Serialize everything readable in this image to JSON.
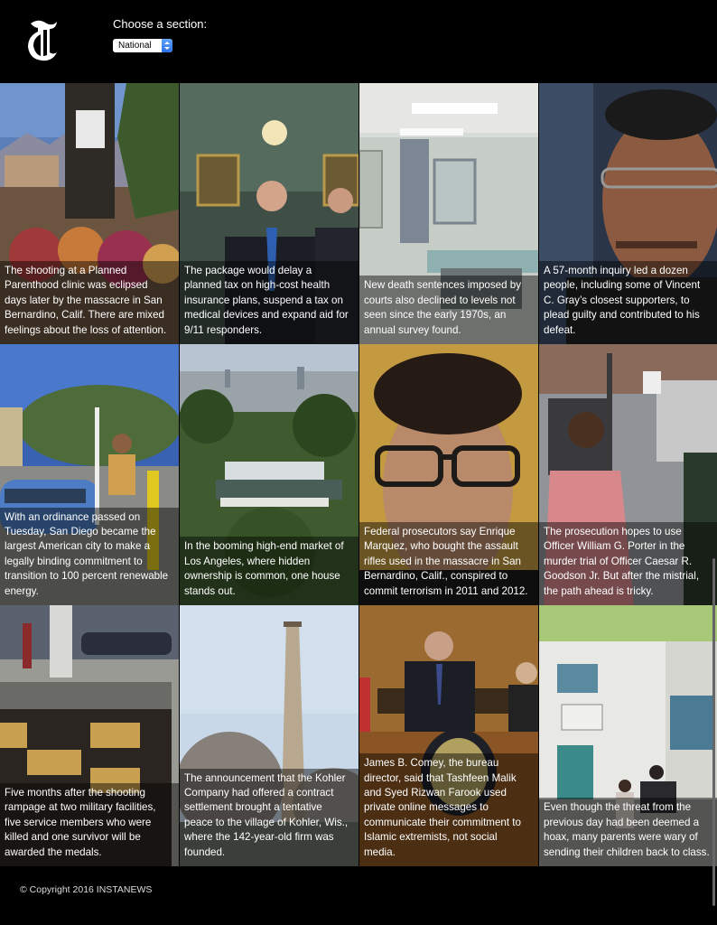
{
  "header": {
    "logo": "nyt-t-logo-icon",
    "choose_label": "Choose a section:",
    "section_value": "National"
  },
  "stories": [
    {
      "caption": "The shooting at a Planned Parenthood clinic was eclipsed days later by the massacre in San Bernardino, Calif. There are mixed feelings about the loss of attention.",
      "image": "clinic-memorial-flowers"
    },
    {
      "caption": "The package would delay a planned tax on high-cost health insurance plans, suspend a tax on medical devices and expand aid for 9/11 responders.",
      "image": "senators-press-conference"
    },
    {
      "caption": "New death sentences imposed by courts also declined to levels not seen since the early 1970s, an annual survey found.",
      "image": "execution-chamber"
    },
    {
      "caption": "A 57-month inquiry led a dozen people, including some of Vincent C. Gray’s closest supporters, to plead guilty and contributed to his defeat.",
      "image": "vincent-gray-portrait"
    },
    {
      "caption": "With an ordinance passed on Tuesday, San Diego became the largest American city to make a legally binding commitment to transition to 100 percent renewable energy.",
      "image": "electric-car-charging"
    },
    {
      "caption": "In the booming high-end market of Los Angeles, where hidden ownership is common, one house stands out.",
      "image": "los-angeles-hillside-house"
    },
    {
      "caption": "Federal prosecutors say Enrique Marquez, who bought the assault rifles used in the massacre in San Bernardino, Calif., conspired to commit terrorism in 2011 and 2012.",
      "image": "enrique-marquez-portrait"
    },
    {
      "caption": "The prosecution hopes to use Officer William G. Porter in the murder trial of Officer Caesar R. Goodson Jr. But after the mistrial, the path ahead is tricky.",
      "image": "baltimore-prosecutor"
    },
    {
      "caption": "Five months after the shooting rampage at two military facilities, five service members who were killed and one survivor will be awarded the medals.",
      "image": "chattanooga-memorial-plaque"
    },
    {
      "caption": "The announcement that the Kohler Company had offered a contract settlement brought a tentative peace to the village of Kohler, Wis., where the 142-year-old firm was founded.",
      "image": "kohler-smokestack"
    },
    {
      "caption": "James B. Comey, the bureau director, said that Tashfeen Malik and Syed Rizwan Farook used private online messages to communicate their commitment to Islamic extremists, not social media.",
      "image": "comey-podium"
    },
    {
      "caption": "Even though the threat from the previous day had been deemed a hoax, many parents were wary of sending their children back to class.",
      "image": "gardner-street-school"
    }
  ],
  "footer": {
    "copyright": "© Copyright 2016 INSTANEWS"
  }
}
